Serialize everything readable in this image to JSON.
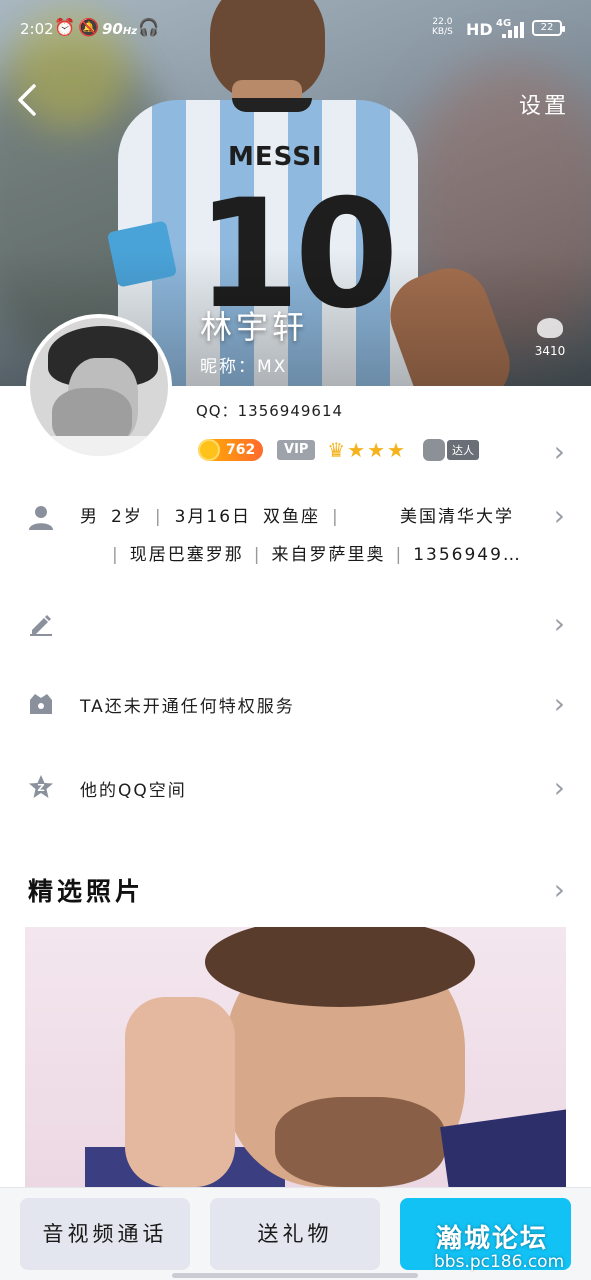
{
  "status_bar": {
    "time": "2:02",
    "refresh_rate": "90",
    "refresh_unit": "Hz",
    "net_speed_value": "22.0",
    "net_speed_unit": "KB/S",
    "hd_label": "HD",
    "network_type": "4G",
    "battery_level": "22"
  },
  "header": {
    "back_icon": "chevron-left-icon",
    "settings_label": "设置",
    "cover_jersey_name": "MESSI",
    "cover_jersey_number": "10",
    "display_name": "林宇轩",
    "nickname_label": "昵称：",
    "nickname_value": "MX",
    "like_icon": "cloud-like-icon",
    "like_count": "3410"
  },
  "profile": {
    "qq_label": "QQ：",
    "qq_number": "1356949614",
    "level_value": "762",
    "vip_label": "VIP",
    "expert_label": "达人",
    "gender": "男",
    "age": "2岁",
    "birthday": "3月16日",
    "zodiac": "双鱼座",
    "school": "美国清华大学",
    "location": "现居巴塞罗那",
    "hometown": "来自罗萨里奥",
    "qq_truncated": "1356949…"
  },
  "rows": {
    "privilege_text": "TA还未开通任何特权服务",
    "qzone_text": "他的QQ空间"
  },
  "photos": {
    "section_title": "精选照片"
  },
  "bottom_bar": {
    "call_label": "音视频通话",
    "gift_label": "送礼物",
    "primary_label": "",
    "watermark_text": "瀚城论坛",
    "watermark_url": "bbs.pc186.com"
  },
  "colors": {
    "primary_button": "#12c2f5",
    "star": "#f6b21a",
    "level_badge": "#ff6a2c",
    "vip_gray": "#9ea3ab"
  }
}
